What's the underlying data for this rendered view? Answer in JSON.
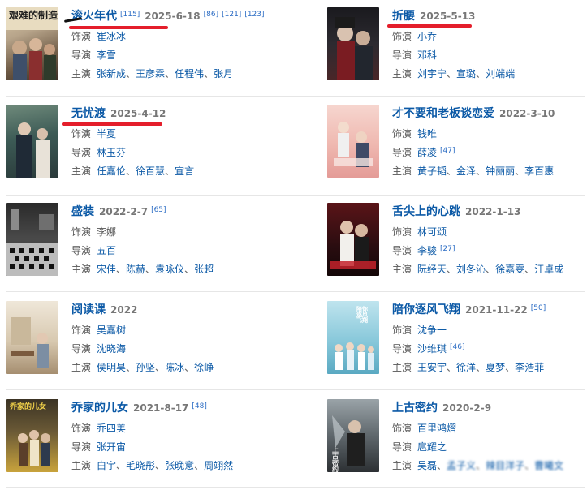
{
  "labels": {
    "actor": "饰演",
    "director": "导演",
    "cast": "主演"
  },
  "entries": [
    {
      "title": "滚火年代",
      "date": "2025-6-18",
      "refs": [
        "[115]",
        "[86]",
        "[121]",
        "[123]"
      ],
      "actor": [
        "崔冰冰"
      ],
      "director": [
        "李雪"
      ],
      "cast": [
        "张新成",
        "王彦霖",
        "任程伟",
        "张月"
      ],
      "poster_text": "艰难的制造",
      "underline": true
    },
    {
      "title": "折腰",
      "date": "2025-5-13",
      "refs": [],
      "actor": [
        "小乔"
      ],
      "director": [
        "邓科"
      ],
      "cast": [
        "刘宇宁",
        "宣璐",
        "刘端端"
      ],
      "poster_text": "",
      "underline": true
    },
    {
      "title": "无忧渡",
      "date": "2025-4-12",
      "refs": [],
      "actor": [
        "半夏"
      ],
      "director": [
        "林玉芬"
      ],
      "cast": [
        "任嘉伦",
        "徐百慧",
        "宣言"
      ],
      "poster_text": "",
      "underline": true
    },
    {
      "title": "才不要和老板谈恋爱",
      "date": "2022-3-10",
      "refs": [],
      "actor": [
        "钱唯"
      ],
      "director": [
        "薛凌"
      ],
      "director_ref": "[47]",
      "cast": [
        "黄子韬",
        "金泽",
        "钟丽丽",
        "李百惠"
      ],
      "poster_text": ""
    },
    {
      "title": "盛装",
      "date": "2022-2-7",
      "refs": [
        "[65]"
      ],
      "actor": [
        "李娜"
      ],
      "director": [
        "五百"
      ],
      "cast": [
        "宋佳",
        "陈赫",
        "袁咏仪",
        "张超"
      ],
      "poster_text": ""
    },
    {
      "title": "舌尖上的心跳",
      "date": "2022-1-13",
      "refs": [],
      "actor": [
        "林可颂"
      ],
      "director": [
        "李骏"
      ],
      "director_ref": "[27]",
      "cast": [
        "阮经天",
        "刘冬沁",
        "徐嘉雯",
        "汪卓成"
      ],
      "poster_text": ""
    },
    {
      "title": "阅读课",
      "date": "2022",
      "refs": [],
      "actor": [
        "吴嘉树"
      ],
      "director": [
        "沈晓海"
      ],
      "cast": [
        "侯明昊",
        "孙坚",
        "陈冰",
        "徐峥"
      ],
      "poster_text": ""
    },
    {
      "title": "陪你逐风飞翔",
      "date": "2021-11-22",
      "refs": [
        "[50]"
      ],
      "actor": [
        "沈争一"
      ],
      "director": [
        "沙维琪"
      ],
      "director_ref": "[46]",
      "cast": [
        "王安宇",
        "徐洋",
        "夏梦",
        "李浩菲"
      ],
      "poster_text": "陪你逐风飞翔"
    },
    {
      "title": "乔家的儿女",
      "date": "2021-8-17",
      "refs": [
        "[48]"
      ],
      "actor": [
        "乔四美"
      ],
      "director": [
        "张开宙"
      ],
      "cast": [
        "白宇",
        "毛晓彤",
        "张晚意",
        "周翊然"
      ],
      "poster_text": "乔家的儿女"
    },
    {
      "title": "上古密约",
      "date": "2020-2-9",
      "refs": [],
      "actor": [
        "百里鸿熠"
      ],
      "director": [
        "扈耀之"
      ],
      "cast": [
        "吴磊",
        "孟子义",
        "辣目洋子",
        "曹曦文"
      ],
      "cast_blurred_from": 1,
      "poster_text": "上古密约"
    }
  ],
  "colors": {
    "link": "#0b59a6",
    "date": "#777777",
    "ref": "#2b6cc4",
    "underline": "#e41e2b"
  }
}
